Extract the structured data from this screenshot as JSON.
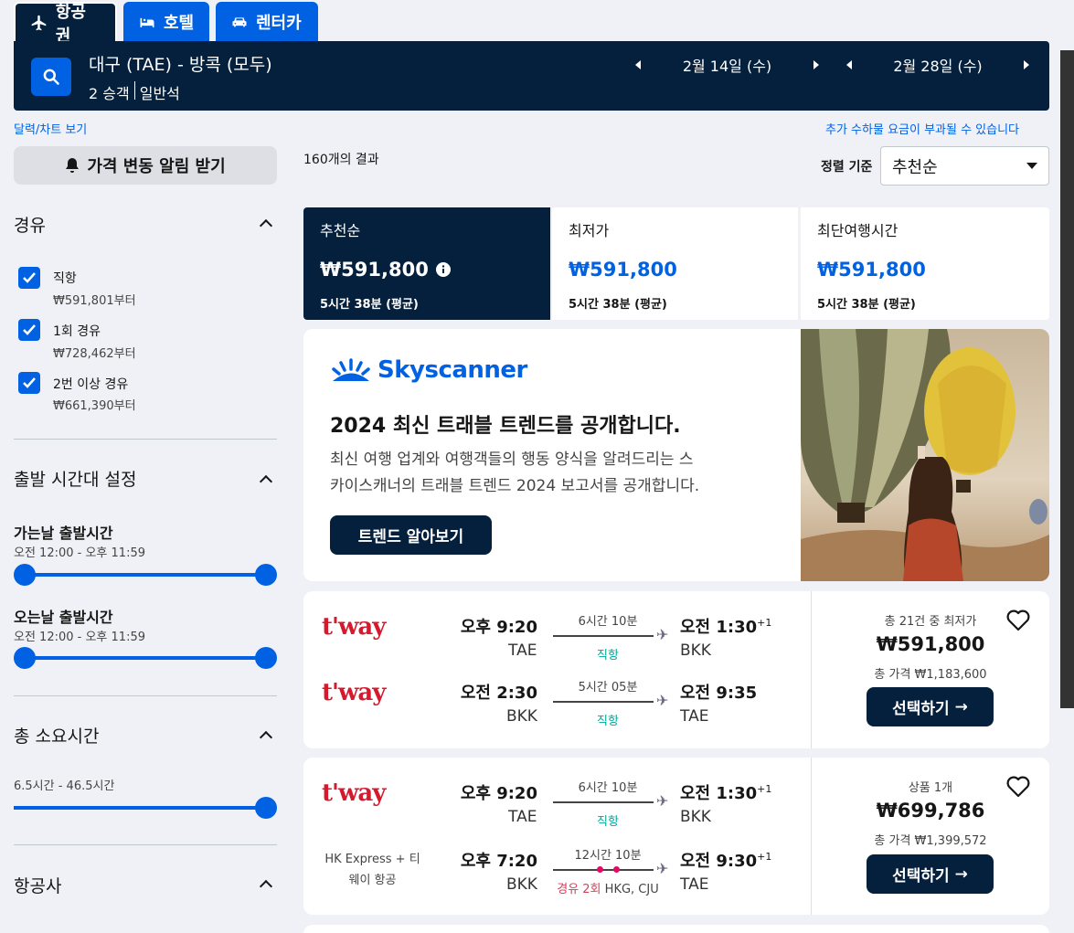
{
  "tabs": [
    {
      "label": "항공권",
      "icon": "plane-icon"
    },
    {
      "label": "호텔",
      "icon": "bed-icon"
    },
    {
      "label": "렌터카",
      "icon": "car-icon"
    }
  ],
  "search": {
    "route": "대구 (TAE) - 방콕 (모두)",
    "passengers": "2 승객",
    "cabin": "일반석",
    "depart_date": "2월 14일 (수)",
    "return_date": "2월 28일 (수)"
  },
  "links": {
    "calendar": "달력/차트 보기",
    "fees_notice": "추가 수하물 요금이 부과될 수 있습니다"
  },
  "alert_button": "가격 변동 알림 받기",
  "filters": {
    "stops": {
      "title": "경유",
      "options": [
        {
          "label": "직항",
          "price": "₩591,801부터",
          "checked": true
        },
        {
          "label": "1회 경유",
          "price": "₩728,462부터",
          "checked": true
        },
        {
          "label": "2번 이상 경유",
          "price": "₩661,390부터",
          "checked": true
        }
      ]
    },
    "times": {
      "title": "출발 시간대 설정",
      "outbound_title": "가는날 출발시간",
      "outbound_range": "오전 12:00 - 오후 11:59",
      "return_title": "오는날 출발시간",
      "return_range": "오전 12:00 - 오후 11:59"
    },
    "duration": {
      "title": "총 소요시간",
      "range": "6.5시간 - 46.5시간"
    },
    "airlines": {
      "title": "항공사"
    }
  },
  "results": {
    "count": "160개의 결과",
    "sort_label": "정렬 기준",
    "sort_value": "추천순"
  },
  "sort_tabs": [
    {
      "title": "추천순",
      "price": "₩591,800",
      "duration": "5시간 38분 (평균)"
    },
    {
      "title": "최저가",
      "price": "₩591,800",
      "duration": "5시간 38분 (평균)"
    },
    {
      "title": "최단여행시간",
      "price": "₩591,800",
      "duration": "5시간 38분 (평균)"
    }
  ],
  "promo": {
    "brand": "Skyscanner",
    "headline": "2024 최신 트래블 트렌드를 공개합니다.",
    "body_line1": "최신 여행 업계와 여행객들의 행동 양식을 알려드리는 스",
    "body_line2": "카이스캐너의 트래블 트렌드 2024 보고서를 공개합니다.",
    "button": "트렌드 알아보기"
  },
  "cards": [
    {
      "legs": [
        {
          "airline": "t'way",
          "dep_time": "오후 9:20",
          "dep_ap": "TAE",
          "duration": "6시간 10분",
          "stops": "직항",
          "arr_time": "오전 1:30",
          "arr_plus": "+1",
          "arr_ap": "BKK"
        },
        {
          "airline": "t'way",
          "dep_time": "오전 2:30",
          "dep_ap": "BKK",
          "duration": "5시간 05분",
          "stops": "직항",
          "arr_time": "오전 9:35",
          "arr_plus": "",
          "arr_ap": "TAE"
        }
      ],
      "deal": "총 21건 중 최저가",
      "price": "₩591,800",
      "total": "총 가격 ₩1,183,600",
      "button": "선택하기"
    },
    {
      "legs": [
        {
          "airline": "t'way",
          "dep_time": "오후 9:20",
          "dep_ap": "TAE",
          "duration": "6시간 10분",
          "stops": "직항",
          "arr_time": "오전 1:30",
          "arr_plus": "+1",
          "arr_ap": "BKK"
        },
        {
          "airline_line1": "HK Express + 티",
          "airline_line2": "웨이 항공",
          "dep_time": "오후 7:20",
          "dep_ap": "BKK",
          "duration": "12시간 10분",
          "stops_red": "경유 2회",
          "stops_via": "HKG, CJU",
          "arr_time": "오전 9:30",
          "arr_plus": "+1",
          "arr_ap": "TAE"
        }
      ],
      "deal": "상품 1개",
      "price": "₩699,786",
      "total": "총 가격 ₩1,399,572",
      "button": "선택하기"
    }
  ],
  "colors": {
    "navy": "#05203c",
    "blue": "#0062e3",
    "teal": "#00a698",
    "red": "#d7192e"
  }
}
